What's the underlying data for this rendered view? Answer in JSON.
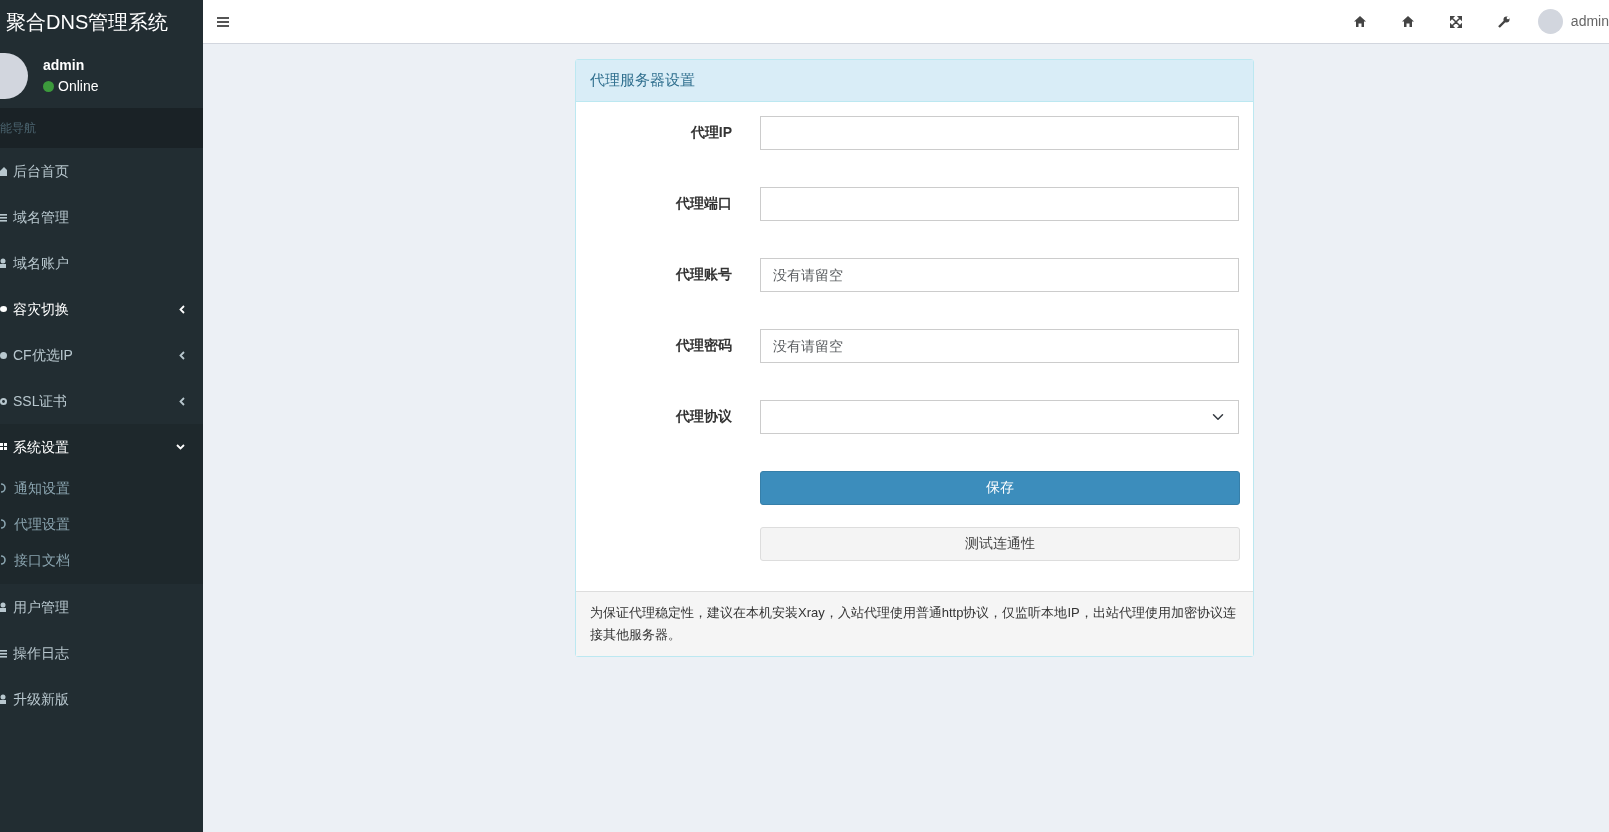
{
  "brand": "聚合DNS管理系统",
  "user": {
    "name": "admin",
    "status": "Online",
    "color": "#3c9a3c"
  },
  "nav_header": "能导航",
  "nav": [
    {
      "label": "后台首页",
      "kind": "link",
      "highlighted": false
    },
    {
      "label": "域名管理",
      "kind": "link",
      "highlighted": false
    },
    {
      "label": "域名账户",
      "kind": "link",
      "highlighted": false
    },
    {
      "label": "容灾切换",
      "kind": "tree",
      "highlighted": true,
      "expanded": false
    },
    {
      "label": "CF优选IP",
      "kind": "tree",
      "highlighted": false,
      "expanded": false
    },
    {
      "label": "SSL证书",
      "kind": "tree",
      "highlighted": false,
      "expanded": false
    },
    {
      "label": "系统设置",
      "kind": "tree",
      "highlighted": true,
      "expanded": true,
      "children": [
        {
          "label": "通知设置",
          "selected": false
        },
        {
          "label": "代理设置",
          "selected": false
        },
        {
          "label": "接口文档",
          "selected": false
        }
      ]
    },
    {
      "label": "用户管理",
      "kind": "link",
      "highlighted": false
    },
    {
      "label": "操作日志",
      "kind": "link",
      "highlighted": false
    },
    {
      "label": "升级新版",
      "kind": "link",
      "highlighted": false
    }
  ],
  "topbar": {
    "user": "admin"
  },
  "panel": {
    "title": "代理服务器设置",
    "fields": [
      {
        "label": "代理IP",
        "kind": "text"
      },
      {
        "label": "代理端口",
        "kind": "text"
      },
      {
        "label": "代理账号",
        "kind": "text",
        "placeholder": "没有请留空"
      },
      {
        "label": "代理密码",
        "kind": "text",
        "placeholder": "没有请留空"
      },
      {
        "label": "代理协议",
        "kind": "select"
      }
    ],
    "buttons": [
      {
        "label": "保存",
        "kind": "primary"
      },
      {
        "label": "测试连通性",
        "kind": "default"
      }
    ],
    "note": "为保证代理稳定性，建议在本机安装Xray，入站代理使用普通http协议，仅监听本地IP，出站代理使用加密协议连接其他服务器。"
  }
}
